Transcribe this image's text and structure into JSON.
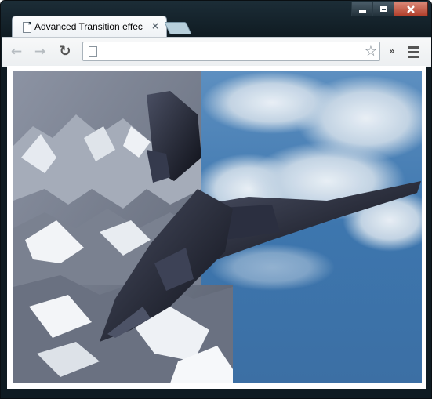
{
  "window": {
    "tab_title": "Advanced Transition effec",
    "tab_close_glyph": "×",
    "controls": {
      "minimize": "minimize",
      "maximize": "maximize",
      "close": "close"
    }
  },
  "toolbar": {
    "back_glyph": "←",
    "forward_glyph": "→",
    "reload_glyph": "↻",
    "address_value": "",
    "star_glyph": "☆",
    "extensions_glyph": "»"
  },
  "icons": {
    "page": "page-icon",
    "star": "star-icon",
    "menu": "hamburger-menu-icon"
  },
  "content": {
    "image_description_colors": {
      "mountain_rock": "#6e7584",
      "snow": "#e9edf2",
      "sky": "#3f78ad",
      "cloud": "#d7e2ec",
      "jet": "#1a1c26"
    }
  }
}
